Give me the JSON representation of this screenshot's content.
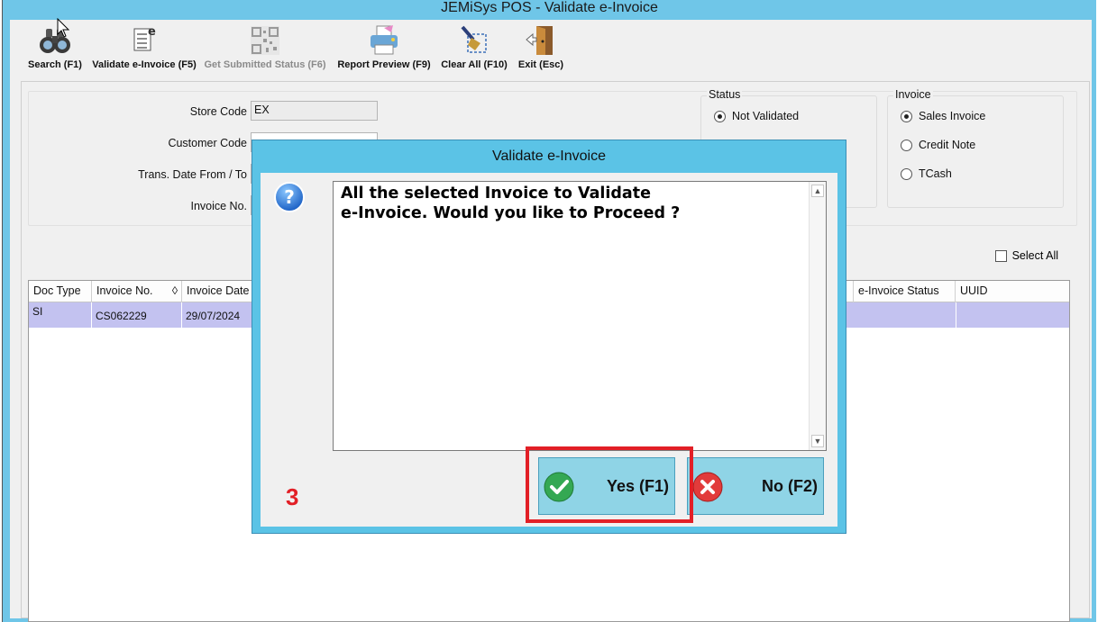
{
  "window": {
    "title": "JEMiSys POS - Validate e-Invoice"
  },
  "toolbar": {
    "search": "Search (F1)",
    "validate": "Validate e-Invoice (F5)",
    "submitted_status": "Get Submitted Status (F6)",
    "report_preview": "Report Preview (F9)",
    "clear_all": "Clear All (F10)",
    "exit": "Exit (Esc)"
  },
  "filters": {
    "store_code_label": "Store Code",
    "store_code_value": "EX",
    "customer_code_label": "Customer Code",
    "trans_date_label": "Trans. Date From / To",
    "invoice_no_label": "Invoice No."
  },
  "status_group": {
    "title": "Status",
    "options": [
      "Not Validated"
    ],
    "selected": "Not Validated"
  },
  "invoice_group": {
    "title": "Invoice",
    "options": [
      "Sales Invoice",
      "Credit Note",
      "TCash"
    ],
    "selected": "Sales Invoice"
  },
  "select_all_label": "Select All",
  "grid": {
    "columns": [
      "Doc Type",
      "Invoice No.",
      "Invoice Date",
      "e-Invoice Status",
      "UUID"
    ],
    "sort_glyph": "◊",
    "rows": [
      {
        "doc_type": "SI",
        "invoice_no": "CS062229",
        "invoice_date": "29/07/2024",
        "status": "",
        "uuid": ""
      }
    ]
  },
  "dialog": {
    "title": "Validate e-Invoice",
    "message": "All the selected Invoice to Validate\ne-Invoice. Would you like to Proceed ?",
    "yes_label": "Yes (F1)",
    "no_label": "No (F2)",
    "step_marker": "3"
  },
  "colors": {
    "frame": "#6fc6e8",
    "dialog_frame": "#5bc3e6",
    "button_bg": "#8fd4e6",
    "selected_row": "#c3c2f0",
    "highlight": "#e21f26"
  }
}
